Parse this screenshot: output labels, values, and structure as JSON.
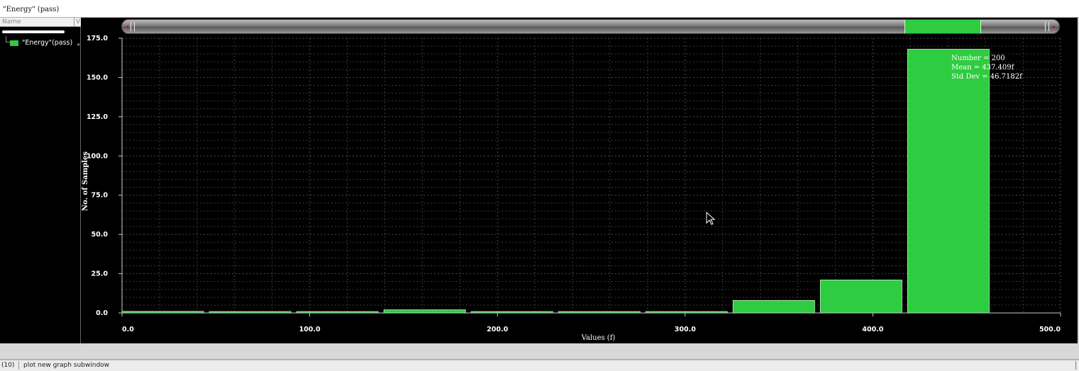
{
  "window": {
    "title": "\"Energy\" (pass)"
  },
  "tree": {
    "header_name": "Name",
    "header_value": "V",
    "items": [
      {
        "label": "\"Energy\"(pass)",
        "color": "#2ecc40"
      }
    ]
  },
  "stats": {
    "number": "Number = 200",
    "mean": "Mean = 437.409f",
    "std": "Std Dev = 46.7182f"
  },
  "status": {
    "number": "(10)",
    "text": "plot new graph subwindow"
  },
  "colors": {
    "bar": "#2ecc40",
    "background": "#000000",
    "grid": "#3a3a3a",
    "text": "#ffffff"
  },
  "chart_data": {
    "type": "bar",
    "xlabel": "Values (f)",
    "ylabel": "No. of Samples",
    "xlim": [
      0,
      500
    ],
    "ylim": [
      0,
      175
    ],
    "xticks": [
      "0.0",
      "100.0",
      "200.0",
      "300.0",
      "400.0",
      "500.0"
    ],
    "yticks": [
      "0.0",
      "25.0",
      "50.0",
      "75.0",
      "100.0",
      "125.0",
      "150.0",
      "175.0"
    ],
    "grid": true,
    "bins": [
      {
        "x0": 0,
        "x1": 43.5,
        "value": 1
      },
      {
        "x0": 46.5,
        "x1": 90,
        "value": 0.5
      },
      {
        "x0": 93,
        "x1": 136.5,
        "value": 0.5
      },
      {
        "x0": 139.5,
        "x1": 183,
        "value": 2
      },
      {
        "x0": 186,
        "x1": 229.5,
        "value": 0.5
      },
      {
        "x0": 232.5,
        "x1": 276,
        "value": 0.5
      },
      {
        "x0": 279,
        "x1": 322.5,
        "value": 0.5
      },
      {
        "x0": 325.5,
        "x1": 369,
        "value": 8
      },
      {
        "x0": 372,
        "x1": 415.5,
        "value": 21
      },
      {
        "x0": 418.5,
        "x1": 462,
        "value": 168
      }
    ]
  }
}
